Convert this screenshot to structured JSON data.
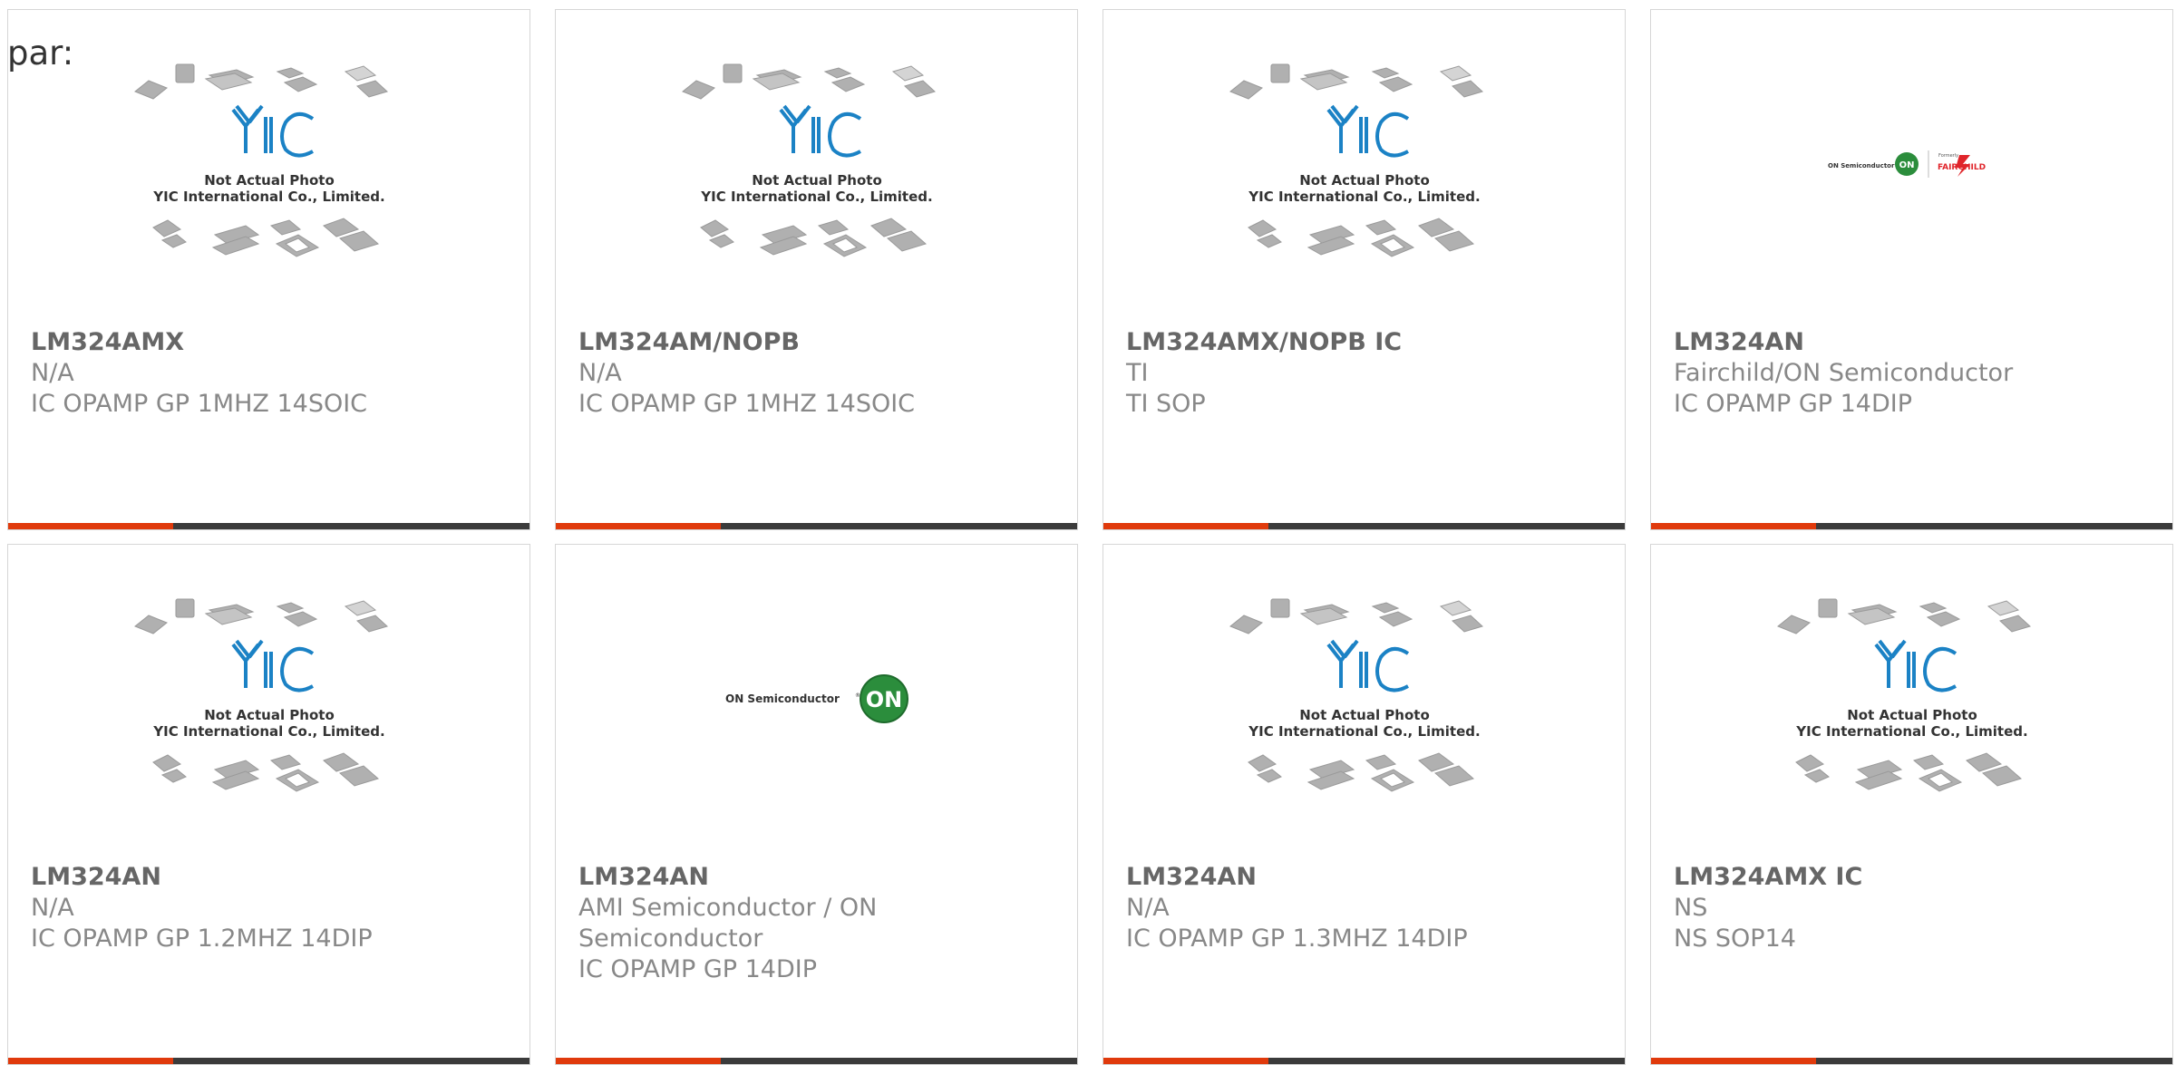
{
  "page_label": "par:",
  "placeholder_text": {
    "line1": "Not Actual Photo",
    "line2": "YIC International Co., Limited.",
    "brand": "YIC"
  },
  "cards": [
    {
      "part": "LM324AMX",
      "manufacturer": "N/A",
      "description": "IC OPAMP GP 1MHZ 14SOIC",
      "image": "yic-placeholder"
    },
    {
      "part": "LM324AM/NOPB",
      "manufacturer": "N/A",
      "description": "IC OPAMP GP 1MHZ 14SOIC",
      "image": "yic-placeholder"
    },
    {
      "part": "LM324AMX/NOPB IC",
      "manufacturer": "TI",
      "description": "TI SOP",
      "image": "yic-placeholder"
    },
    {
      "part": "LM324AN",
      "manufacturer": "Fairchild/ON Semiconductor",
      "description": "IC OPAMP GP 14DIP",
      "image": "on-fairchild-logo",
      "logo_text": {
        "on": "ON Semiconductor",
        "formerly": "Formerly",
        "fairchild": "FAIRCHILD"
      }
    },
    {
      "part": "LM324AN",
      "manufacturer": "N/A",
      "description": "IC OPAMP GP 1.2MHZ 14DIP",
      "image": "yic-placeholder"
    },
    {
      "part": "LM324AN",
      "manufacturer": "AMI Semiconductor / ON Semiconductor",
      "description": "IC OPAMP GP 14DIP",
      "image": "on-semi-logo",
      "logo_text": {
        "on": "ON Semiconductor"
      }
    },
    {
      "part": "LM324AN",
      "manufacturer": "N/A",
      "description": "IC OPAMP GP 1.3MHZ 14DIP",
      "image": "yic-placeholder"
    },
    {
      "part": "LM324AMX IC",
      "manufacturer": "NS",
      "description": "NS SOP14",
      "image": "yic-placeholder"
    }
  ],
  "colors": {
    "accent": "#e03a0c",
    "bar": "#3b3b3b",
    "border": "#d6d6d6",
    "yic_blue": "#1b82c5"
  }
}
